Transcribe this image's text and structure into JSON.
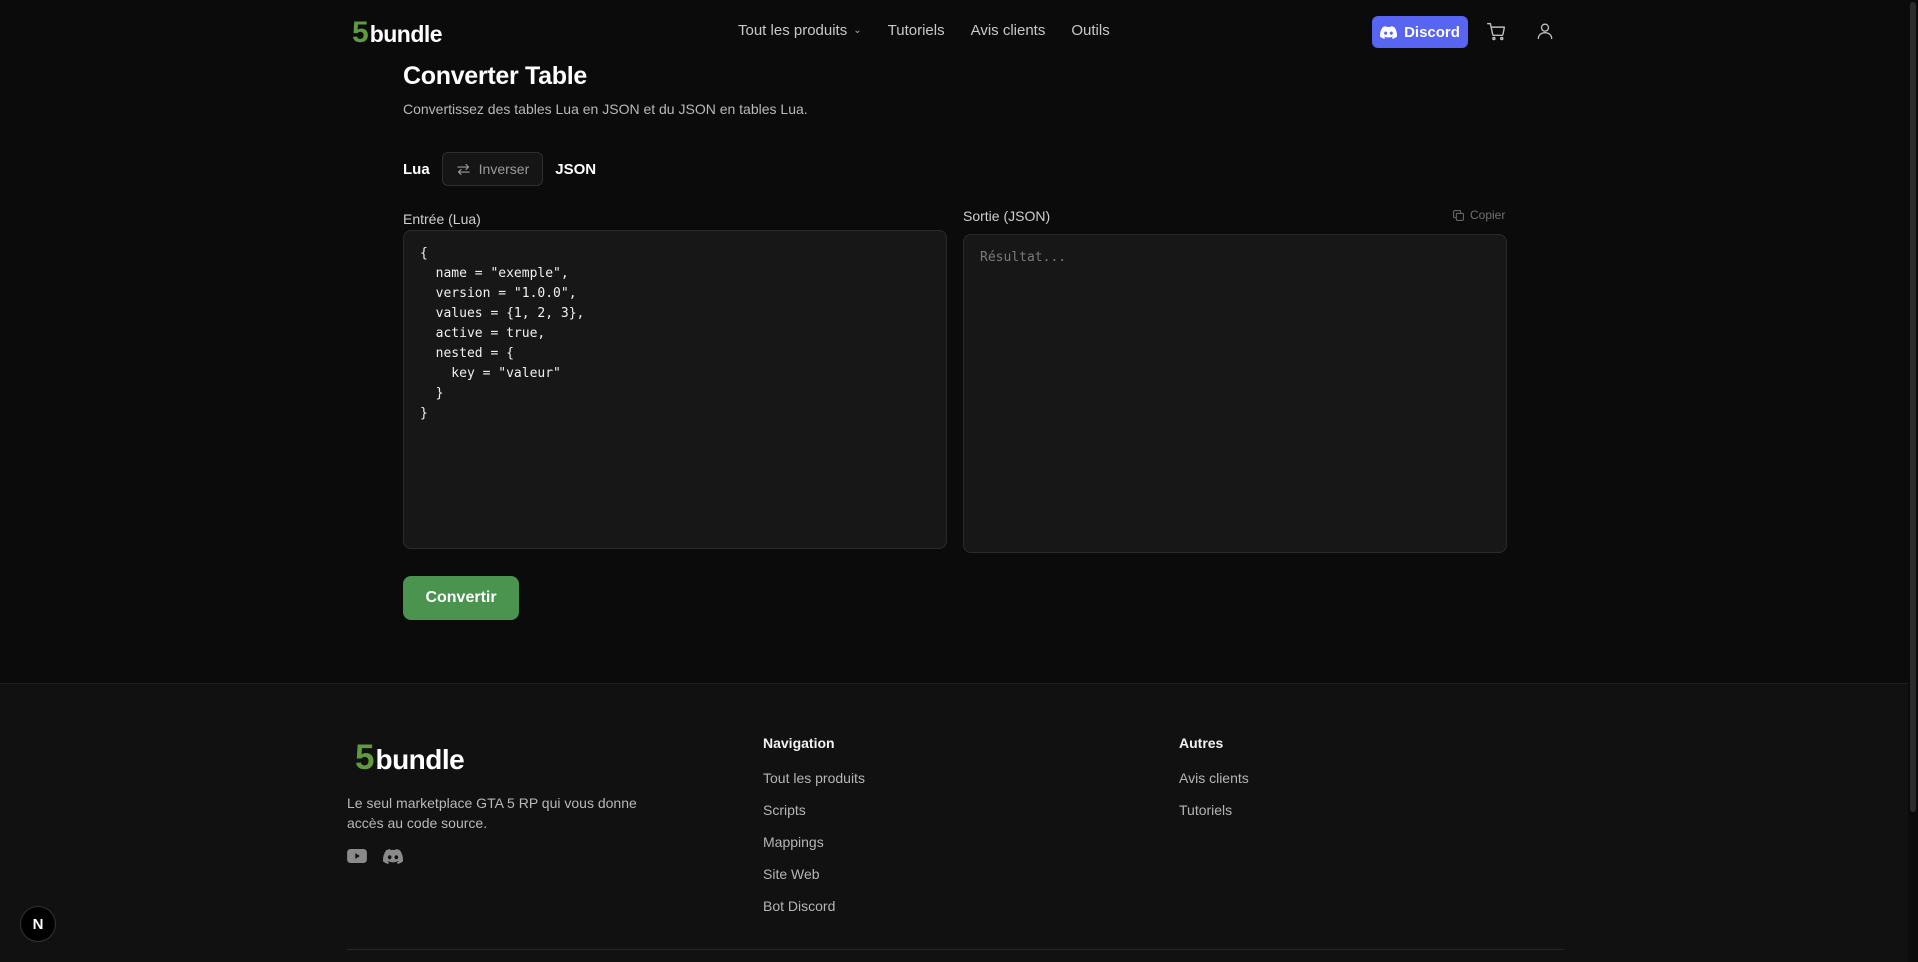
{
  "header": {
    "logo_number": "5",
    "logo_word": "bundle",
    "nav": [
      {
        "label": "Tout les produits",
        "has_dropdown": true
      },
      {
        "label": "Tutoriels"
      },
      {
        "label": "Avis clients"
      },
      {
        "label": "Outils"
      }
    ],
    "discord_label": "Discord",
    "icons": {
      "cart": "cart-icon",
      "account": "user-icon",
      "discord": "discord-icon"
    }
  },
  "main": {
    "title": "Converter Table",
    "subtitle": "Convertissez des tables Lua en JSON et du JSON en tables Lua.",
    "mode_from": "Lua",
    "swap_label": "Inverser",
    "mode_to": "JSON",
    "input_label": "Entrée (Lua)",
    "output_label": "Sortie (JSON)",
    "copy_label": "Copier",
    "input_value": "{\n  name = \"exemple\",\n  version = \"1.0.0\",\n  values = {1, 2, 3},\n  active = true,\n  nested = {\n    key = \"valeur\"\n  }\n}",
    "output_placeholder": "Résultat...",
    "convert_label": "Convertir"
  },
  "footer": {
    "logo_number": "5",
    "logo_word": "bundle",
    "tagline": "Le seul marketplace GTA 5 RP qui vous donne accès au code source.",
    "socials": [
      "youtube-icon",
      "discord-icon"
    ],
    "navigation_title": "Navigation",
    "navigation": [
      "Tout les produits",
      "Scripts",
      "Mappings",
      "Site Web",
      "Bot Discord"
    ],
    "others_title": "Autres",
    "others": [
      "Avis clients",
      "Tutoriels"
    ]
  },
  "badge": "N",
  "colors": {
    "background": "#0b0b0b",
    "brand_green": "#5e9b3f",
    "convert_button": "#4a9450",
    "discord_blue": "#5865f2"
  }
}
